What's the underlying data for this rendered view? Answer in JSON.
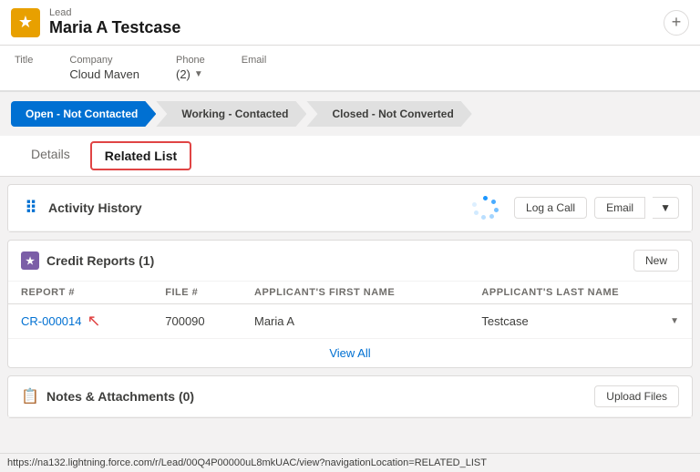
{
  "record": {
    "type": "Lead",
    "name": "Maria A Testcase"
  },
  "highlights": {
    "title_label": "Title",
    "company_label": "Company",
    "company_value": "Cloud Maven",
    "phone_label": "Phone (2)",
    "email_label": "Email"
  },
  "stages": [
    {
      "label": "Open - Not Contacted",
      "active": true
    },
    {
      "label": "Working - Contacted",
      "active": false
    },
    {
      "label": "Closed - Not Converted",
      "active": false
    }
  ],
  "tabs": [
    {
      "label": "Details",
      "active": false
    },
    {
      "label": "Related List",
      "active": true
    }
  ],
  "activity_history": {
    "title": "Activity History",
    "log_call_label": "Log a Call",
    "email_label": "Email"
  },
  "credit_reports": {
    "title": "Credit Reports",
    "count": "(1)",
    "new_label": "New",
    "columns": [
      "Report #",
      "File #",
      "Applicant's First Name",
      "Applicant's Last Name"
    ],
    "rows": [
      {
        "report_num": "CR-000014",
        "file_num": "700090",
        "first_name": "Maria A",
        "last_name": "Testcase"
      }
    ],
    "view_all_label": "View All"
  },
  "notes_attachments": {
    "title": "Notes & Attachments",
    "count": "(0)",
    "upload_label": "Upload Files"
  },
  "status_bar": {
    "url": "https://na132.lightning.force.com/r/Lead/00Q4P00000uL8mkUAC/view?navigationLocation=RELATED_LIST"
  },
  "icons": {
    "lead_icon": "★",
    "add_icon": "+",
    "star_icon": "★",
    "notes_icon": "📋",
    "chevron_down": "▼",
    "dropdown_arrow": "▼"
  }
}
